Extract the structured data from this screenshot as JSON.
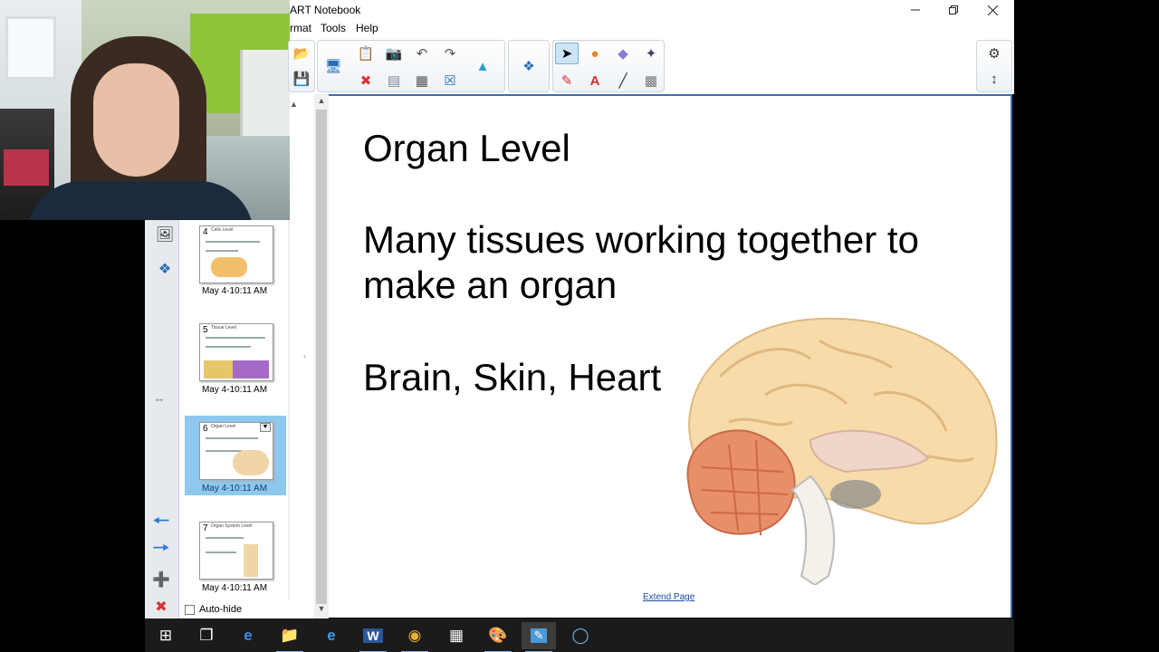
{
  "window": {
    "title": "ART Notebook",
    "minimize_icon": "minimize-icon",
    "restore_icon": "restore-icon",
    "close_icon": "close-icon"
  },
  "menu": {
    "items": [
      "rmat",
      "Tools",
      "Help"
    ]
  },
  "toolbar": {
    "icons": [
      "open-icon",
      "save-icon",
      "screen-shade-icon",
      "paste-icon",
      "delete-icon",
      "screen-capture-icon",
      "insert-screen-icon",
      "undo-icon",
      "table-icon",
      "redo-icon",
      "clear-icon",
      "full-screen-icon",
      "addon-icon",
      "select-icon",
      "pens-icon",
      "shapes-icon",
      "text-icon",
      "eraser-icon",
      "line-icon",
      "magic-pen-icon",
      "settings-icon",
      "move-toolbar-icon"
    ]
  },
  "side_tabs": {
    "icons": [
      "gallery-icon",
      "addons-icon",
      "resize-icon",
      "back-arrow-icon",
      "forward-arrow-icon",
      "add-page-icon",
      "delete-page-icon"
    ]
  },
  "page_sorter": {
    "thumbnails": [
      {
        "number": "4",
        "title": "Cells Level",
        "label": "May 4-10:11 AM"
      },
      {
        "number": "5",
        "title": "Tissue Level",
        "label": "May 4-10:11 AM"
      },
      {
        "number": "6",
        "title": "Organ Level",
        "label": "May 4-10:11 AM"
      },
      {
        "number": "7",
        "title": "Organ System Level",
        "label": "May 4-10:11 AM"
      }
    ],
    "autohide_label": "Auto-hide"
  },
  "slide": {
    "title": "Organ Level",
    "line1": "Many tissues working together to",
    "line2": "make an organ",
    "examples": "Brain, Skin, Heart",
    "extend_page": "Extend Page"
  },
  "taskbar": {
    "icons": [
      "windows-start-icon",
      "task-view-icon",
      "edge-icon",
      "file-explorer-icon",
      "internet-explorer-icon",
      "word-icon",
      "chrome-icon",
      "calculator-icon",
      "paint-icon",
      "smart-notebook-icon",
      "cortana-icon"
    ]
  },
  "colors": {
    "canvas_border": "#3d6fb6",
    "selected_thumb": "#8ec8ef",
    "taskbar": "#1b1b1b"
  }
}
